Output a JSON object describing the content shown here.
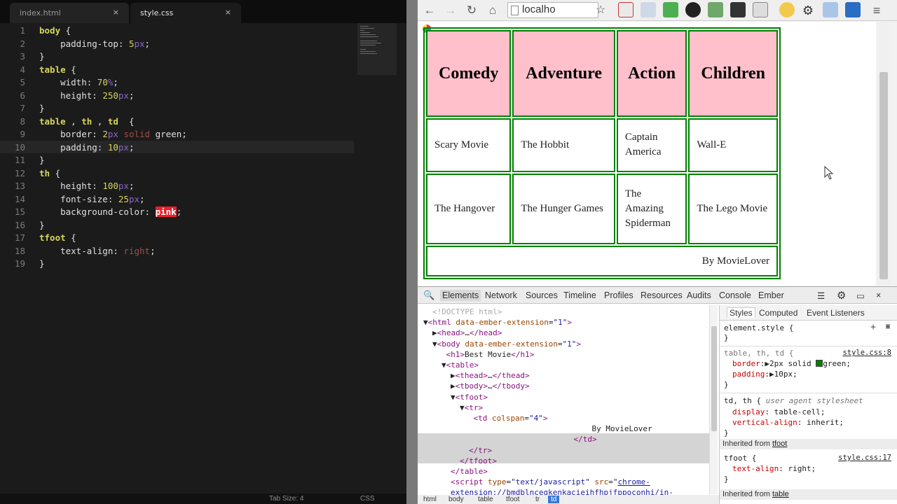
{
  "editor": {
    "tabs": [
      {
        "label": "index.html",
        "close": "×"
      },
      {
        "label": "style.css",
        "close": "×"
      }
    ],
    "lines": [
      {
        "n": "1",
        "segs": [
          [
            "sel",
            "body"
          ],
          [
            "val",
            " {"
          ]
        ]
      },
      {
        "n": "2",
        "segs": [
          [
            "prop",
            "    padding-top: "
          ],
          [
            "num",
            "5"
          ],
          [
            "unit",
            "px"
          ],
          [
            "val",
            ";"
          ]
        ]
      },
      {
        "n": "3",
        "segs": [
          [
            "val",
            "}"
          ]
        ]
      },
      {
        "n": "4",
        "segs": [
          [
            "sel",
            "table"
          ],
          [
            "val",
            " {"
          ]
        ]
      },
      {
        "n": "5",
        "segs": [
          [
            "prop",
            "    width: "
          ],
          [
            "num",
            "70"
          ],
          [
            "unit",
            "%"
          ],
          [
            "val",
            ";"
          ]
        ]
      },
      {
        "n": "6",
        "segs": [
          [
            "prop",
            "    height: "
          ],
          [
            "num",
            "250"
          ],
          [
            "unit",
            "px"
          ],
          [
            "val",
            ";"
          ]
        ]
      },
      {
        "n": "7",
        "segs": [
          [
            "val",
            "}"
          ]
        ]
      },
      {
        "n": "8",
        "segs": [
          [
            "sel",
            "table"
          ],
          [
            "val",
            " , "
          ],
          [
            "sel",
            "th"
          ],
          [
            "val",
            " , "
          ],
          [
            "sel",
            "td"
          ],
          [
            "val",
            "  {"
          ]
        ]
      },
      {
        "n": "9",
        "segs": [
          [
            "prop",
            "    border: "
          ],
          [
            "num",
            "2"
          ],
          [
            "unit",
            "px"
          ],
          [
            "val",
            " "
          ],
          [
            "kw",
            "solid"
          ],
          [
            "val",
            " green;"
          ]
        ]
      },
      {
        "n": "10",
        "segs": [
          [
            "prop",
            "    padding: "
          ],
          [
            "num",
            "10"
          ],
          [
            "unit",
            "px"
          ],
          [
            "val",
            ";"
          ]
        ]
      },
      {
        "n": "11",
        "segs": [
          [
            "val",
            "}"
          ]
        ]
      },
      {
        "n": "12",
        "segs": [
          [
            "sel",
            "th"
          ],
          [
            "val",
            " {"
          ]
        ]
      },
      {
        "n": "13",
        "segs": [
          [
            "prop",
            "    height: "
          ],
          [
            "num",
            "100"
          ],
          [
            "unit",
            "px"
          ],
          [
            "val",
            ";"
          ]
        ]
      },
      {
        "n": "14",
        "segs": [
          [
            "prop",
            "    font-size: "
          ],
          [
            "num",
            "25"
          ],
          [
            "unit",
            "px"
          ],
          [
            "val",
            ";"
          ]
        ]
      },
      {
        "n": "15",
        "segs": [
          [
            "prop",
            "    background-color: "
          ],
          [
            "hl",
            "pink"
          ],
          [
            "val",
            ";"
          ]
        ]
      },
      {
        "n": "16",
        "segs": [
          [
            "val",
            "}"
          ]
        ]
      },
      {
        "n": "17",
        "segs": [
          [
            "sel",
            "tfoot"
          ],
          [
            "val",
            " {"
          ]
        ]
      },
      {
        "n": "18",
        "segs": [
          [
            "prop",
            "    text-align: "
          ],
          [
            "kw",
            "right"
          ],
          [
            "val",
            ";"
          ]
        ]
      },
      {
        "n": "19",
        "segs": [
          [
            "val",
            "}"
          ]
        ]
      }
    ],
    "status": {
      "tab_size": "Tab Size: 4",
      "syntax": "CSS"
    }
  },
  "browser": {
    "address": "localho",
    "nav": {
      "back": "←",
      "forward": "→",
      "reload": "↻",
      "home": "⌂",
      "star": "☆",
      "menu": "≡"
    },
    "table": {
      "headers": [
        "Comedy",
        "Adventure",
        "Action",
        "Children"
      ],
      "rows": [
        [
          "Scary Movie",
          "The Hobbit",
          "Captain America",
          "Wall-E"
        ],
        [
          "The Hangover",
          "The Hunger Games",
          "The Amazing Spiderman",
          "The Lego Movie"
        ]
      ],
      "footer": "By MovieLover"
    }
  },
  "devtools": {
    "tabs": [
      "Elements",
      "Network",
      "Sources",
      "Timeline",
      "Profiles",
      "Resources",
      "Audits",
      "Console",
      "Ember"
    ],
    "dom": [
      {
        "indent": 2,
        "html": "<span class='cm'>&lt;!DOCTYPE html&gt;</span>"
      },
      {
        "indent": 0,
        "html": "▼<span class='tg'>&lt;html</span> <span class='at'>data-ember-extension</span>=<span class='av'>\"1\"</span><span class='tg'>&gt;</span>"
      },
      {
        "indent": 2,
        "html": "▶<span class='tg'>&lt;head&gt;</span>…<span class='tg'>&lt;/head&gt;</span>"
      },
      {
        "indent": 2,
        "html": "▼<span class='tg'>&lt;body</span> <span class='at'>data-ember-extension</span>=<span class='av'>\"1\"</span><span class='tg'>&gt;</span>"
      },
      {
        "indent": 5,
        "html": "<span class='tg'>&lt;h1&gt;</span>Best Movie<span class='tg'>&lt;/h1&gt;</span>"
      },
      {
        "indent": 4,
        "html": "▼<span class='tg'>&lt;table&gt;</span>"
      },
      {
        "indent": 6,
        "html": "▶<span class='tg'>&lt;thead&gt;</span>…<span class='tg'>&lt;/thead&gt;</span>"
      },
      {
        "indent": 6,
        "html": "▶<span class='tg'>&lt;tbody&gt;</span>…<span class='tg'>&lt;/tbody&gt;</span>"
      },
      {
        "indent": 6,
        "html": "▼<span class='tg'>&lt;tfoot&gt;</span>"
      },
      {
        "indent": 8,
        "html": "▼<span class='tg'>&lt;tr&gt;</span>"
      },
      {
        "indent": 11,
        "html": "<span class='tg'>&lt;td</span> <span class='at'>colspan</span>=<span class='av'>\"4\"</span><span class='tg'>&gt;</span>"
      },
      {
        "indent": 37,
        "html": "By MovieLover"
      },
      {
        "indent": 33,
        "html": "<span class='tg'>&lt;/td&gt;</span>"
      },
      {
        "indent": 10,
        "html": "<span class='tg'>&lt;/tr&gt;</span>"
      },
      {
        "indent": 8,
        "html": "<span class='tg'>&lt;/tfoot&gt;</span>"
      },
      {
        "indent": 6,
        "html": "<span class='tg'>&lt;/table&gt;</span>"
      },
      {
        "indent": 6,
        "html": "<span class='tg'>&lt;script</span> <span class='at'>type</span>=<span class='av'>\"text/javascript\"</span> <span class='at'>src</span>=<span class='av'>\"<span class='lk'>chrome-</span></span>"
      },
      {
        "indent": 6,
        "html": "<span class='lk'>extension://bmdblncegkenkacieihfhpjfppoconhi/in-</span>"
      }
    ],
    "crumbs": [
      "html",
      "body",
      "table",
      "tfoot",
      "tr",
      "td"
    ],
    "styles_tabs": [
      "Styles",
      "Computed",
      "Event Listeners"
    ],
    "styles": {
      "element_style": "element.style {",
      "close": "}",
      "rule1_selector": "table, th, td {",
      "rule1_src": "style.css:8",
      "rule1_border_prop": "border",
      "rule1_border_val": "2px solid",
      "rule1_border_color": "green",
      "rule1_padding_prop": "padding",
      "rule1_padding_val": "10px",
      "rule2_selector": "td, th {",
      "rule2_src": "user agent stylesheet",
      "rule2_display_prop": "display",
      "rule2_display_val": "table-cell",
      "rule2_valign_prop": "vertical-align",
      "rule2_valign_val": "inherit",
      "inherited1_label": "Inherited from",
      "inherited1_tag": "tfoot",
      "rule3_selector": "tfoot {",
      "rule3_src": "style.css:17",
      "rule3_align_prop": "text-align",
      "rule3_align_val": "right",
      "inherited2_label": "Inherited from",
      "inherited2_tag": "table"
    }
  }
}
